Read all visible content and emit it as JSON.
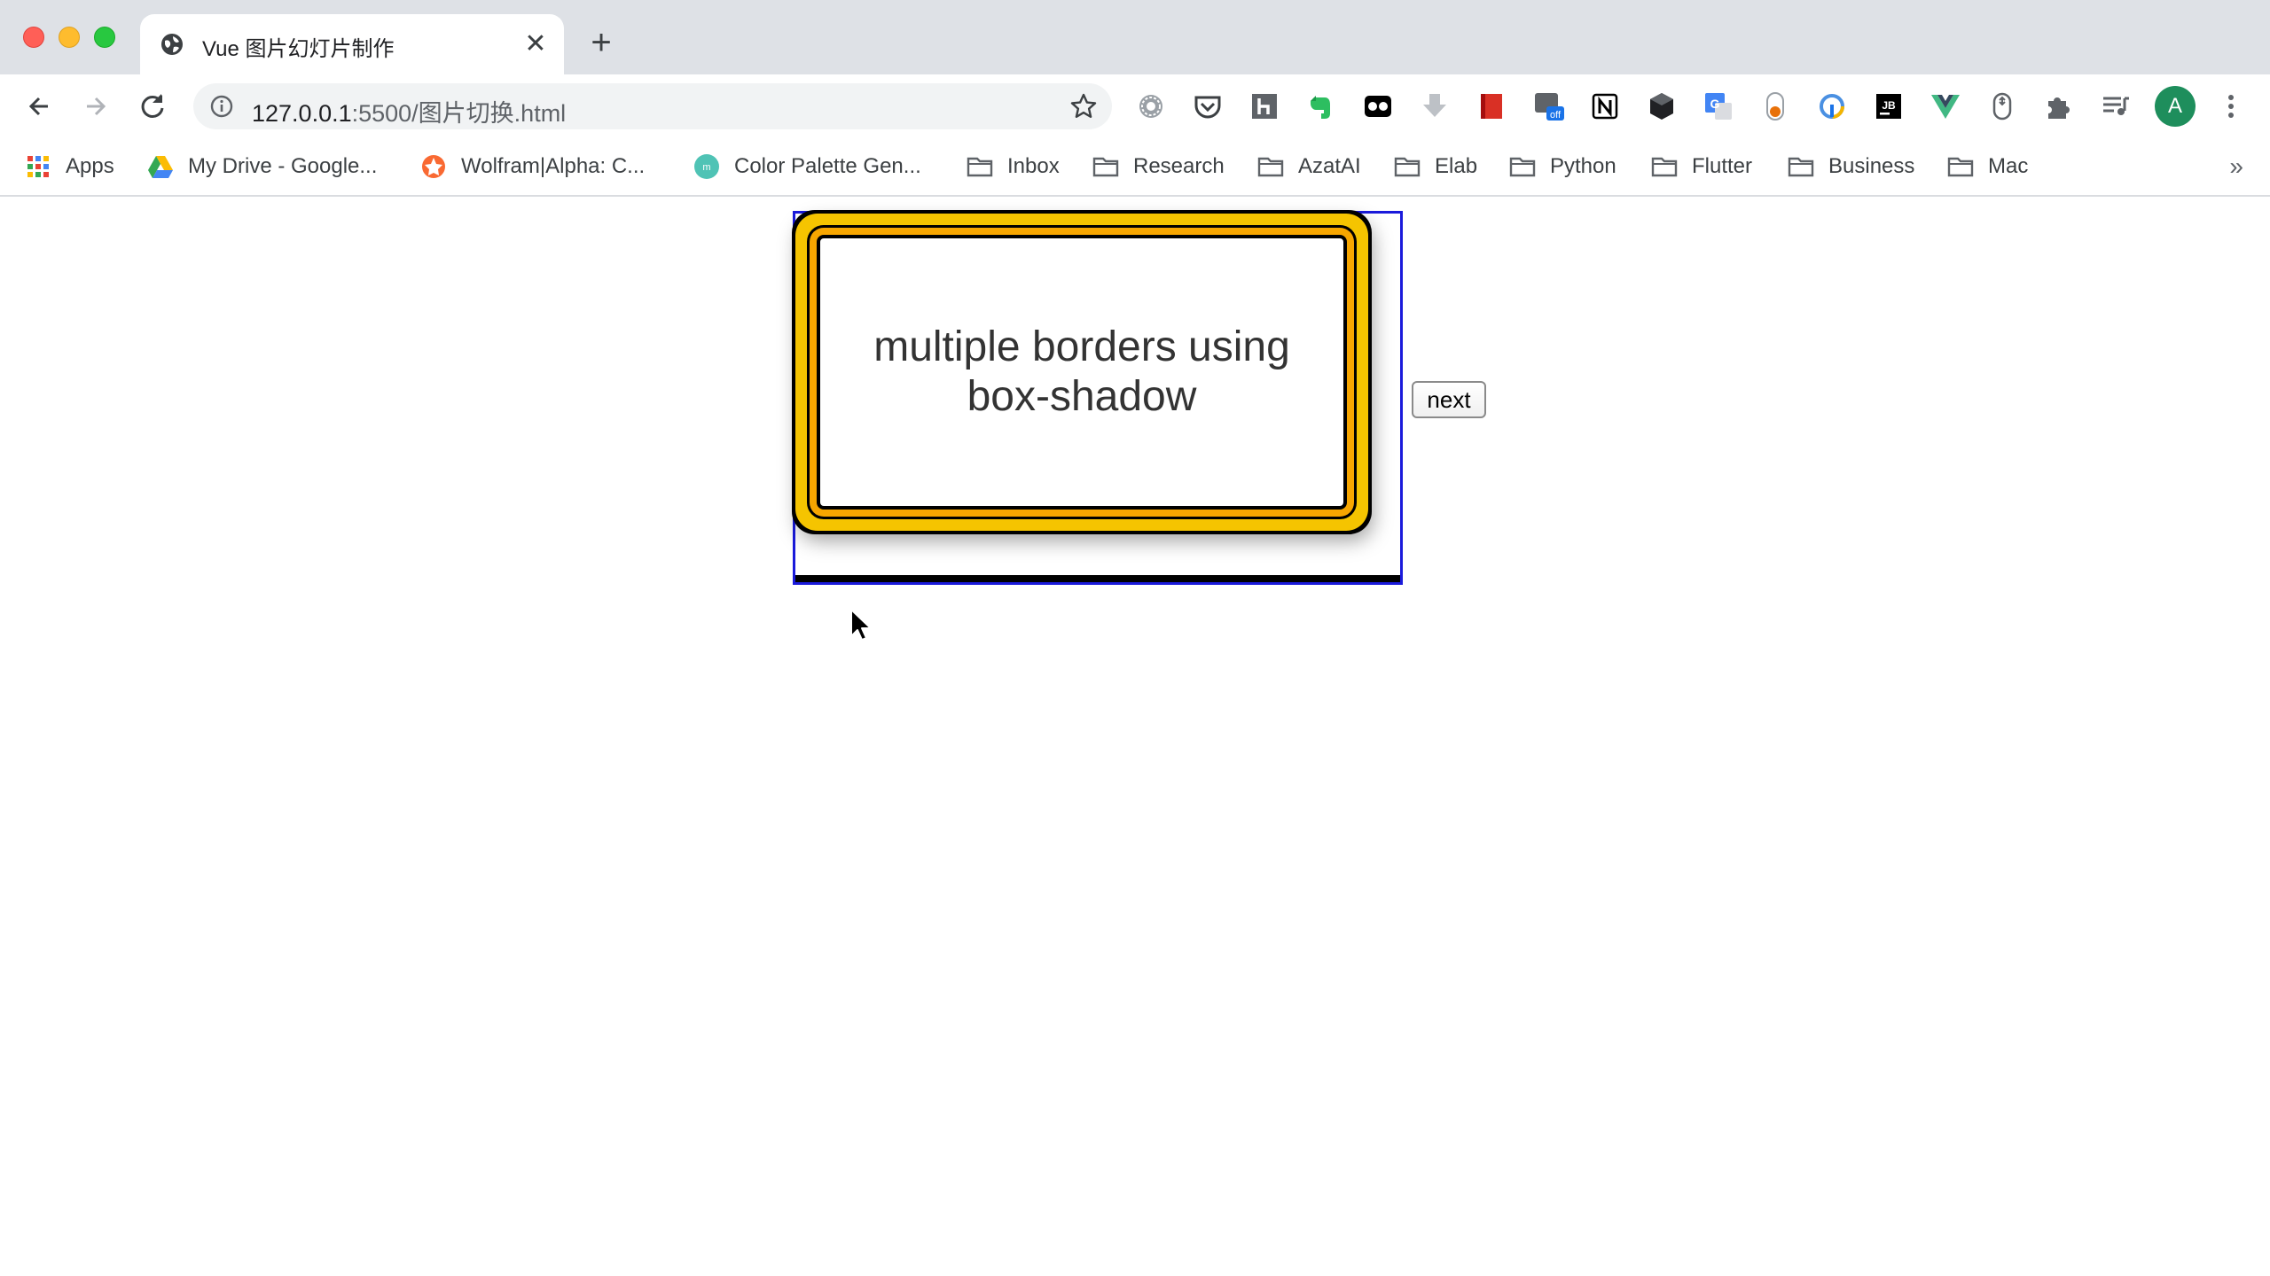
{
  "browser": {
    "tab": {
      "title": "Vue 图片幻灯片制作",
      "close_label": "✕"
    },
    "new_tab_label": "+",
    "url": {
      "host": "127.0.0.1",
      "rest": ":5500/图片切换.html"
    },
    "profile_initial": "A",
    "extensions": [
      "settings-gear",
      "pocket",
      "hashnode",
      "evernote",
      "tab-manager",
      "download",
      "books",
      "screen-recorder-off",
      "notion",
      "cube",
      "google-translate",
      "toggl",
      "spoke",
      "jetbrains",
      "vue-devtools",
      "mouse",
      "extensions-puzzle",
      "media-queue"
    ],
    "extension_badge": "off"
  },
  "bookmarks": [
    {
      "label": "Apps",
      "icon": "apps-grid"
    },
    {
      "label": "My Drive - Google...",
      "icon": "google-drive"
    },
    {
      "label": "Wolfram|Alpha: C...",
      "icon": "wolfram"
    },
    {
      "label": "Color Palette Gen...",
      "icon": "palette"
    },
    {
      "label": "Inbox",
      "icon": "folder"
    },
    {
      "label": "Research",
      "icon": "folder"
    },
    {
      "label": "AzatAI",
      "icon": "folder"
    },
    {
      "label": "Elab",
      "icon": "folder"
    },
    {
      "label": "Python",
      "icon": "folder"
    },
    {
      "label": "Flutter",
      "icon": "folder"
    },
    {
      "label": "Business",
      "icon": "folder"
    },
    {
      "label": "Mac",
      "icon": "folder"
    }
  ],
  "bookmarks_more": "»",
  "page": {
    "slide_text": "multiple borders using box-shadow",
    "next_label": "next"
  },
  "colors": {
    "frame_border": "#1a1adb",
    "border_orange": "#f7a600",
    "border_yellow": "#f5c400"
  }
}
